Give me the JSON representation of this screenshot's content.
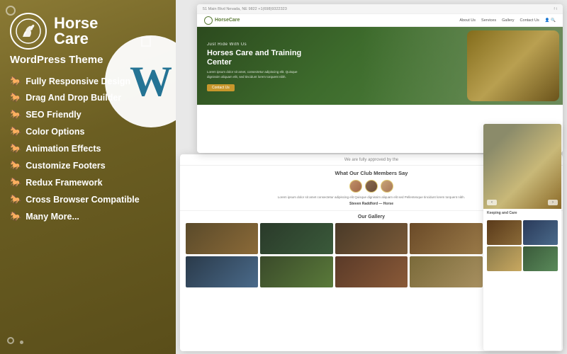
{
  "sidebar": {
    "logo": {
      "horse_text": "Horse",
      "care_text": "Care",
      "theme_label": "WordPress Theme"
    },
    "features": [
      {
        "icon": "⚙",
        "text": "Fully Responsive Design"
      },
      {
        "icon": "⚙",
        "text": "Drag And Drop Builder"
      },
      {
        "icon": "⚙",
        "text": "SEO Friendly"
      },
      {
        "icon": "⚙",
        "text": "Color Options"
      },
      {
        "icon": "⚙",
        "text": "Animation Effects"
      },
      {
        "icon": "⚙",
        "text": "Customize Footers"
      },
      {
        "icon": "⚙",
        "text": "Redux Framework"
      },
      {
        "icon": "⚙",
        "text": "Cross Browser Compatible"
      },
      {
        "icon": "⚙",
        "text": "Many More..."
      }
    ]
  },
  "browser": {
    "address": "51 Main Blvd Nevada, NE 9822   +1(698)9322323",
    "nav_links": [
      "About Us",
      "Services",
      "Gallery",
      "Contact Us"
    ],
    "brand": "HorseCare",
    "hero_subtitle": "Just Ride With Us",
    "hero_title": "Horses Care and Training Center",
    "hero_desc": "Lorem ipsum dolor sit amet, consectetur adipiscing elit. Quisque dignissim aliquam elit, sed tincidunt lorem torquent nibh.",
    "hero_btn": "Contact Us",
    "approved_text": "We are fully approved by the",
    "testimonial_title": "What Our Club Members Say",
    "testimonial_text": "Lorem ipsum dolor sit amet consectetur adipiscing elit Quisque dignissim aliquam elit sed Pellentesque tincidunt lorem torquent nibh.",
    "testimonial_author": "Steven Raddford — Horse",
    "gallery_title": "Our Gallery",
    "rp_label": "Keeping and Care"
  }
}
